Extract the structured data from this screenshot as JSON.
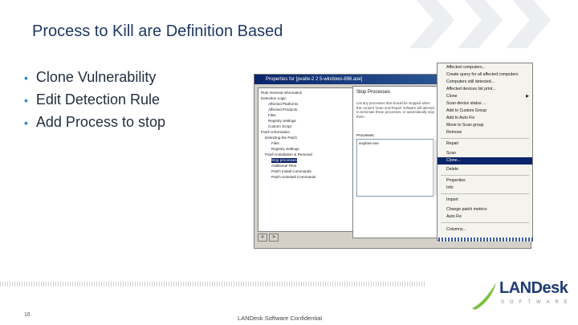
{
  "slide": {
    "title": "Process to Kill are Definition Based",
    "bullets": [
      "Clone Vulnerability",
      "Edit Detection Rule",
      "Add Process to stop"
    ],
    "page_number": "16",
    "footer": "LANDesk Software Confidential",
    "logo_text": "LANDesk",
    "logo_sub": "SOFTWARE"
  },
  "dialog": {
    "title": "Properties for [pvalle-2 2 5-windows-896.ase]",
    "tree": [
      "Rule General Information",
      "Detection Logic",
      "Affected Platforms",
      "Affected Products",
      "Files",
      "Registry Settings",
      "Custom Script",
      "Patch Information",
      "Detecting the Patch",
      "Files",
      "Registry Settings",
      "Patch Installation & Removal",
      "Stop processes",
      "Additional Files",
      "Patch Install Commands",
      "Patch Uninstall Commands"
    ],
    "panel_title": "Stop Processes",
    "panel_desc": "List any processes that should be stopped when this content 'Scan and Repair' software will attempt to terminate these processes, or automatically stop them.",
    "processes_label": "Processes:",
    "processes": [
      "iexplore.exe"
    ]
  },
  "context_menu": {
    "items": [
      "Affected computers...",
      "Create query for all affected computers",
      "Computers still detected...",
      "Affected devices list print...",
      "Clone",
      "Scan device status ...",
      "Add to Custom Group",
      "Add to Auto Fix",
      "Move to Scan group",
      "Remove",
      "Repair",
      "Scan",
      "Clone...",
      "Delete",
      "Properties",
      "Info",
      "Import",
      "Change patch metrics",
      "Auto Fix",
      "Columns..."
    ],
    "highlighted": "Clone..."
  }
}
